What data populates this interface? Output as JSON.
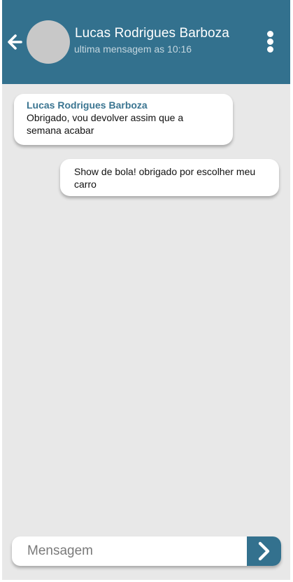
{
  "header": {
    "contact_name": "Lucas Rodrigues Barboza",
    "last_seen": "ultima mensagem as 10:16",
    "back_icon": "arrow-left-icon",
    "menu_icon": "more-vertical-icon"
  },
  "messages": [
    {
      "direction": "incoming",
      "sender": "Lucas Rodrigues Barboza",
      "lines": [
        "Obrigado, vou devolver assim que a",
        "semana acabar"
      ]
    },
    {
      "direction": "outgoing",
      "lines": [
        "Show de bola! obrigado por escolher meu",
        "carro"
      ]
    }
  ],
  "composer": {
    "placeholder": "Mensagem",
    "send_icon": "chevron-right-icon"
  },
  "colors": {
    "accent": "#33718e",
    "background": "#e8e8e8",
    "bubble": "#ffffff",
    "sender_name": "#3b7591"
  }
}
